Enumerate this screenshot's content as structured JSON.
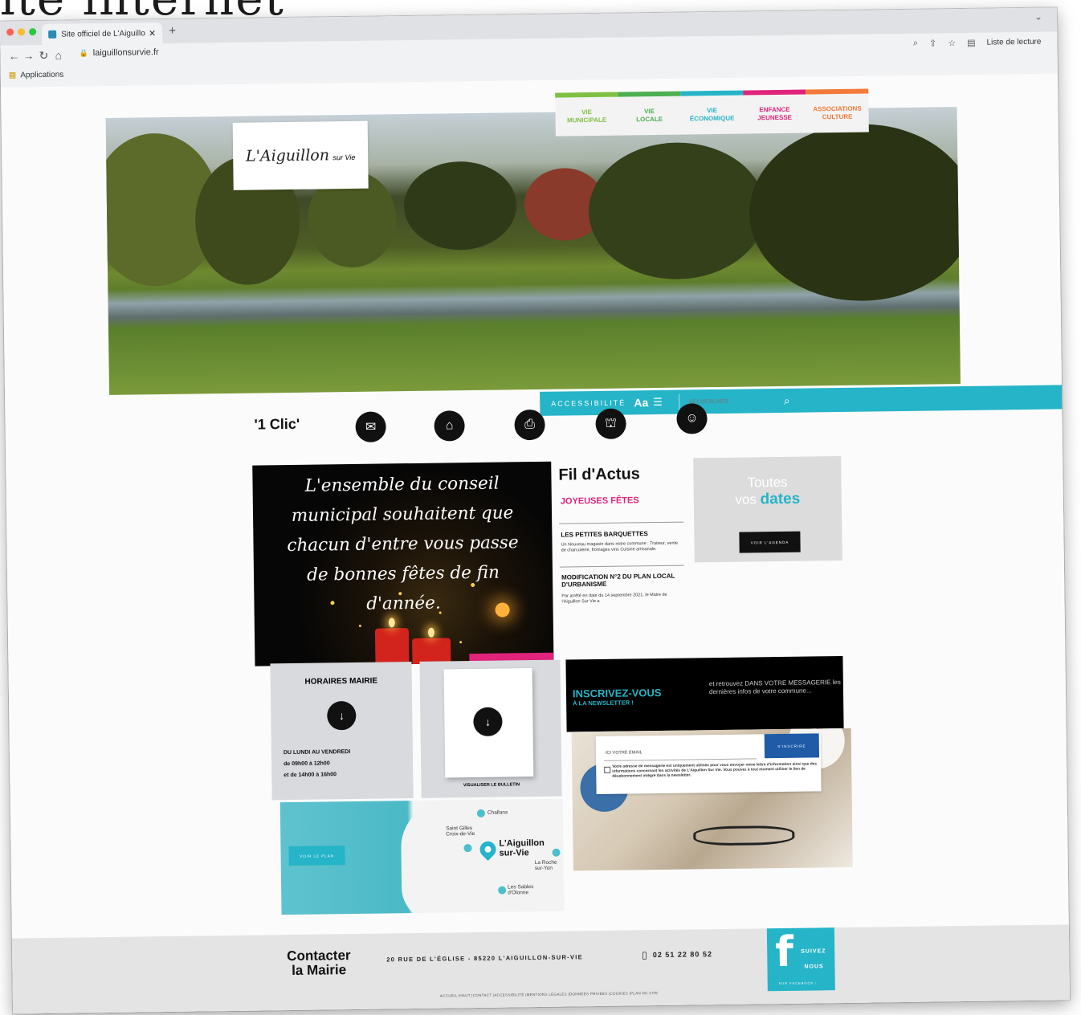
{
  "heading": "ite internet",
  "browser": {
    "tab_title": "Site officiel de L'Aiguillon sur V",
    "url": "laiguillonsurvie.fr",
    "bookmarks_apps": "Applications",
    "reading_list": "Liste de lecture"
  },
  "site": {
    "logo": "L'Aiguillon",
    "logo_sub": "sur Vie",
    "nav": [
      {
        "line1": "VIE",
        "line2": "MUNICIPALE",
        "color": "#7ec142"
      },
      {
        "line1": "VIE",
        "line2": "LOCALE",
        "color": "#4caf50"
      },
      {
        "line1": "VIE",
        "line2": "ÉCONOMIQUE",
        "color": "#25b4c8"
      },
      {
        "line1": "ENFANCE",
        "line2": "JEUNESSE",
        "color": "#e0237b"
      },
      {
        "line1": "ASSOCIATIONS",
        "line2": "CULTURE",
        "color": "#f37a3a"
      }
    ],
    "accessibility": {
      "label": "ACCESSIBILITÉ",
      "aa": "Aa",
      "search_placeholder": "RECHERCHER"
    },
    "one_click": {
      "label": "'1 Clic'",
      "icons": [
        "envelope-icon",
        "town-hall-icon",
        "document-download-icon",
        "school-icon",
        "people-group-icon"
      ]
    },
    "greeting": {
      "lines": [
        "L'ensemble du conseil",
        "municipal souhaitent que",
        "chacun d'entre vous passe",
        "de bonnes fêtes de fin",
        "d'année."
      ]
    },
    "fil_actus": {
      "title": "Fil d'Actus",
      "highlight": "JOYEUSES FÊTES",
      "items": [
        {
          "title": "LES PETITES BARQUETTES",
          "body": "Un Nouveau magasin dans notre commune : Traiteur, vente de charcuterie, fromages vins Cuisine artisanale."
        },
        {
          "title": "MODIFICATION N°2 DU PLAN LOCAL D'URBANISME",
          "body": "Par arrêté en date du 14 septembre 2021, le Maire de l'Aiguillon Sur Vie a"
        }
      ]
    },
    "agenda": {
      "line1": "Toutes",
      "line2_prefix": "vos ",
      "line2_big": "dates",
      "button": "VOIR L'AGENDA"
    },
    "horaires": {
      "title": "HORAIRES MAIRIE",
      "line1": "DU LUNDI AU VENDREDI",
      "line2": "de 09h00 à 12h00",
      "line3": "et de 14h00 à 16h00"
    },
    "bulletin": {
      "label": "VISUALISER LE BULLETIN"
    },
    "newsletter": {
      "title": "INSCRIVEZ-VOUS",
      "title2": "À LA NEWSLETTER !",
      "right_text": "et retrouvez DANS VOTRE MESSAGERIE les dernières infos de votre commune...",
      "email_placeholder": "ICI VOTRE EMAIL",
      "subscribe": "S'INSCRIRE",
      "legal": "Votre adresse de messagerie est uniquement utilisée pour vous envoyer notre lettre d'information ainsi que des informations concernant les activités de L'Aiguillon Sur Vie. Vous pouvez à tout moment utiliser le lien de désabonnement intégré dans la newsletter."
    },
    "map": {
      "button": "VOIR LE PLAN",
      "cities": {
        "challans": "Challans",
        "saint_gilles_1": "Saint Gilles",
        "saint_gilles_2": "Croix-de-Vie",
        "main_1": "L'Aiguillon",
        "main_2": "sur-Vie",
        "roche_1": "La Roche",
        "roche_2": "sur-Yon",
        "sables_1": "Les Sables",
        "sables_2": "d'Olonne"
      }
    },
    "footer": {
      "contact_1": "Contacter",
      "contact_2": "la Mairie",
      "address": "20 RUE DE L'ÉGLISE - 85220 L'AIGUILLON-SUR-VIE",
      "phone": "02 51 22 80 52",
      "links": "ACCUEIL |HAUT |CONTACT |ACCESSIBILITÉ |MENTIONS LÉGALES |DONNÉES PRIVÉES |COOKIES |PLAN DU SITE",
      "fb_1": "SUIVEZ",
      "fb_2": "NOUS",
      "fb_3": "SUR FACEBOOK !"
    }
  }
}
